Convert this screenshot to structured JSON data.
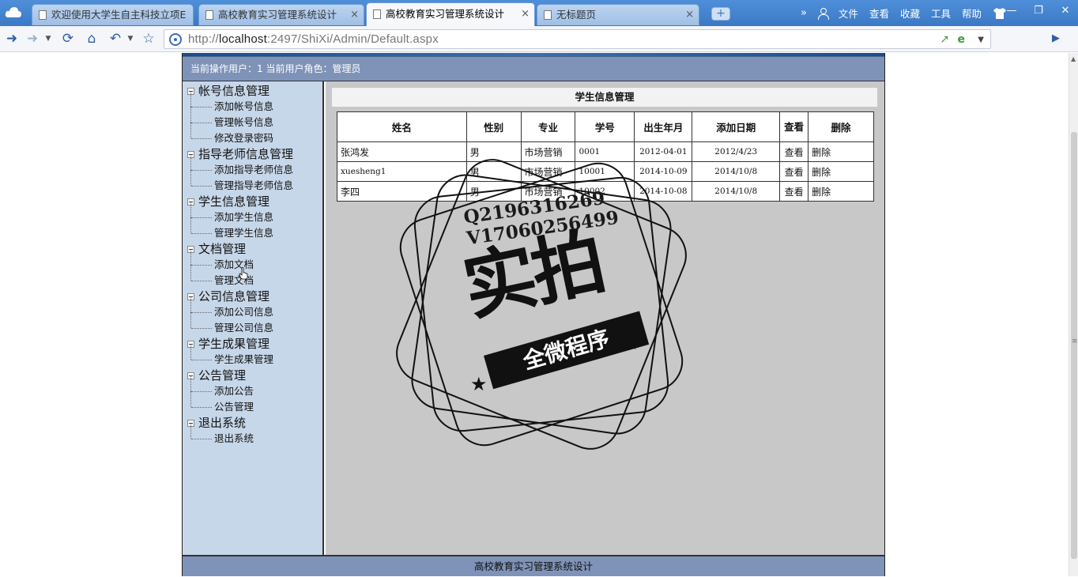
{
  "browser": {
    "tabs": [
      {
        "label": "欢迎使用大学生自主科技立项E"
      },
      {
        "label": "高校教育实习管理系统设计"
      },
      {
        "label": "高校教育实习管理系统设计"
      },
      {
        "label": "无标题页"
      }
    ],
    "tab_close": "×",
    "new_tab": "+",
    "menu": {
      "more": "»",
      "file": "文件",
      "view": "查看",
      "favorites": "收藏",
      "tools": "工具",
      "help": "帮助"
    },
    "window_controls": {
      "minimize": "—",
      "restore": "❐",
      "close": "✕"
    },
    "url_prefix": "http://",
    "url_host": "localhost",
    "url_rest": ":2497/ShiXi/Admin/Default.aspx"
  },
  "page": {
    "userbar": "当前操作用户：1 当前用户角色：管理员",
    "sidebar": [
      {
        "title": "帐号信息管理",
        "items": [
          "添加帐号信息",
          "管理帐号信息",
          "修改登录密码"
        ]
      },
      {
        "title": "指导老师信息管理",
        "items": [
          "添加指导老师信息",
          "管理指导老师信息"
        ]
      },
      {
        "title": "学生信息管理",
        "items": [
          "添加学生信息",
          "管理学生信息"
        ]
      },
      {
        "title": "文档管理",
        "items": [
          "添加文档",
          "管理文档"
        ]
      },
      {
        "title": "公司信息管理",
        "items": [
          "添加公司信息",
          "管理公司信息"
        ]
      },
      {
        "title": "学生成果管理",
        "items": [
          "学生成果管理"
        ]
      },
      {
        "title": "公告管理",
        "items": [
          "添加公告",
          "公告管理"
        ]
      },
      {
        "title": "退出系统",
        "items": [
          "退出系统"
        ]
      }
    ],
    "content_title": "学生信息管理",
    "table": {
      "headers": [
        "姓名",
        "性别",
        "专业",
        "学号",
        "出生年月",
        "添加日期",
        "查看",
        "删除"
      ],
      "rows": [
        [
          "张鸿发",
          "男",
          "市场营销",
          "0001",
          "2012-04-01",
          "2012/4/23",
          "查看",
          "删除"
        ],
        [
          "xuesheng1",
          "男",
          "市场营销",
          "10001",
          "2014-10-09",
          "2014/10/8",
          "查看",
          "删除"
        ],
        [
          "李四",
          "男",
          "市场营销",
          "10002",
          "2014-10-08",
          "2014/10/8",
          "查看",
          "删除"
        ]
      ]
    },
    "footer": "高校教育实习管理系统设计"
  },
  "watermark": {
    "line1": "Q2196316269",
    "line2": "V17060256499",
    "main": "实拍",
    "ribbon": "全微程序"
  }
}
